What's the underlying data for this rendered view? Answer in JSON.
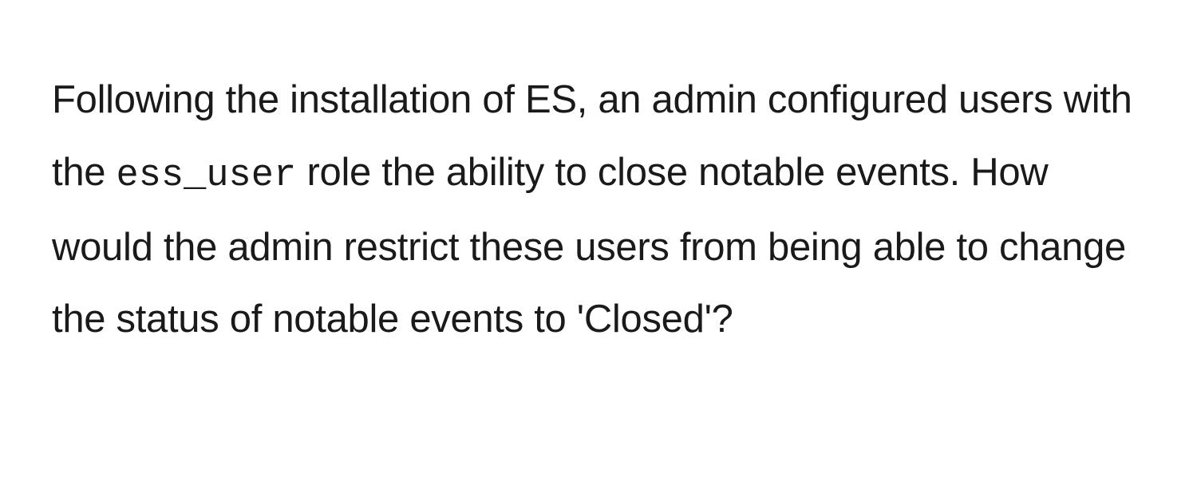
{
  "question": {
    "part1": "Following the installation of ES, an admin configured users with the ",
    "code": "ess_user",
    "part2": " role the ability to close notable events. How would the admin restrict these users from being able to change the status of notable events to 'Closed'?"
  }
}
